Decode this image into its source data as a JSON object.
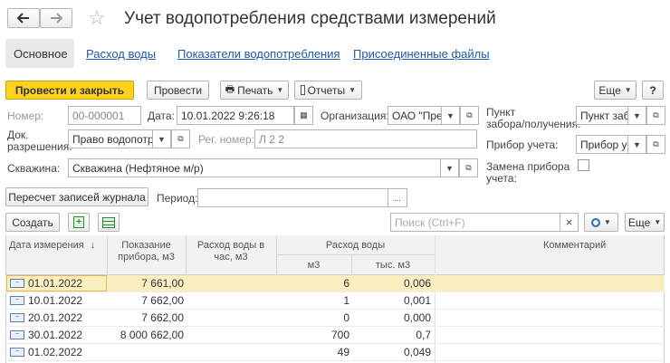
{
  "window": {
    "title": "Учет водопотребления средствами измерений",
    "tabs": [
      "Основное",
      "Расход воды",
      "Показатели водопотребления",
      "Присоединенные файлы"
    ]
  },
  "toolbar": {
    "post_close": "Провести и закрыть",
    "post": "Провести",
    "print": "Печать",
    "reports": "Отчеты",
    "more": "Еще",
    "help": "?"
  },
  "form": {
    "number_label": "Номер:",
    "number_value": "00-000001",
    "date_label": "Дата:",
    "date_value": "10.01.2022  9:26:18",
    "org_label": "Организация:",
    "org_value": "ОАО \"Пре",
    "permit_label_1": "Док.",
    "permit_label_2": "разрешения:",
    "permit_value": "Право водопотре",
    "reg_number_label": "Рег. номер:",
    "reg_number_value": "Л 2 2",
    "well_label": "Скважина:",
    "well_value": "Скважина (Нефтяное м/р)",
    "point_label_1": "Пункт",
    "point_label_2": "забора/получения:",
    "point_value": "Пункт заб",
    "device_label": "Прибор учета:",
    "device_value": "Прибор уч",
    "replace_label_1": "Замена прибора",
    "replace_label_2": "учета:",
    "recalc_button": "Пересчет записей журнала",
    "period_label": "Период:",
    "period_value": "",
    "period_button": "..."
  },
  "table_toolbar": {
    "create": "Создать",
    "search_placeholder": "Поиск (Ctrl+F)",
    "clear": "×",
    "more": "Еще"
  },
  "table": {
    "headers": {
      "date": "Дата измерения",
      "reading_1": "Показание",
      "reading_2": "прибора, м3",
      "hourly_1": "Расход воды в",
      "hourly_2": "час, м3",
      "consumption": "Расход воды",
      "m3": "м3",
      "thousand_m3": "тыс. м3",
      "comment": "Комментарий"
    },
    "sort_indicator": "↓",
    "rows": [
      {
        "date": "01.01.2022",
        "reading": "7 661,00",
        "hourly": "",
        "m3": "6",
        "thousand": "0,006",
        "comment": ""
      },
      {
        "date": "10.01.2022",
        "reading": "7 662,00",
        "hourly": "",
        "m3": "1",
        "thousand": "0,001",
        "comment": ""
      },
      {
        "date": "20.01.2022",
        "reading": "7 662,00",
        "hourly": "",
        "m3": "0",
        "thousand": "0,000",
        "comment": ""
      },
      {
        "date": "30.01.2022",
        "reading": "8 000 662,00",
        "hourly": "",
        "m3": "700",
        "thousand": "0,7",
        "comment": ""
      },
      {
        "date": "01.02.2022",
        "reading": "",
        "hourly": "",
        "m3": "49",
        "thousand": "0,049",
        "comment": ""
      }
    ]
  },
  "colors": {
    "primary_button": "#ffd21f",
    "selected_row": "#fbeec0",
    "link": "#1f5aa8"
  }
}
